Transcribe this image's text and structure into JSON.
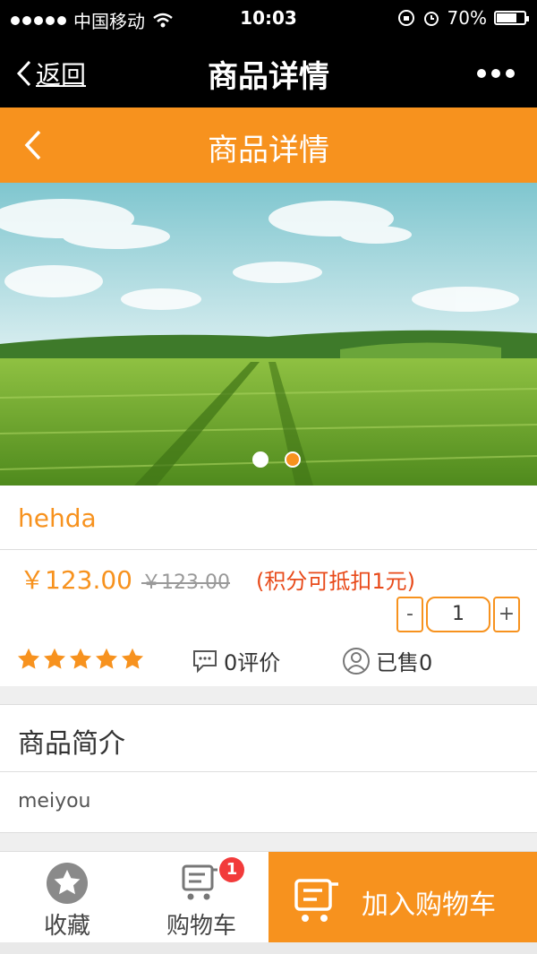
{
  "status_bar": {
    "carrier": "中国移动",
    "time": "10:03",
    "battery": "70%"
  },
  "wechat_nav": {
    "back_label": "返回",
    "title": "商品详情"
  },
  "header": {
    "title": "商品详情"
  },
  "banner": {
    "slide_count": 2,
    "active_slide": 2
  },
  "product": {
    "name": "hehda",
    "price": "￥123.00",
    "original_price": "￥123.00",
    "points_note": "(积分可抵扣1元)",
    "quantity": {
      "minus": "-",
      "value": "1",
      "plus": "+"
    },
    "rating_stars": 5,
    "reviews": "0评价",
    "sold": "已售0"
  },
  "intro": {
    "heading": "商品简介",
    "text": "meiyou"
  },
  "bottom_bar": {
    "favorite_label": "收藏",
    "cart_label": "购物车",
    "cart_badge": "1",
    "add_to_cart_label": "加入购物车"
  },
  "colors": {
    "accent": "#f7921e",
    "points": "#e84a1a",
    "badge": "#f23b3b"
  }
}
